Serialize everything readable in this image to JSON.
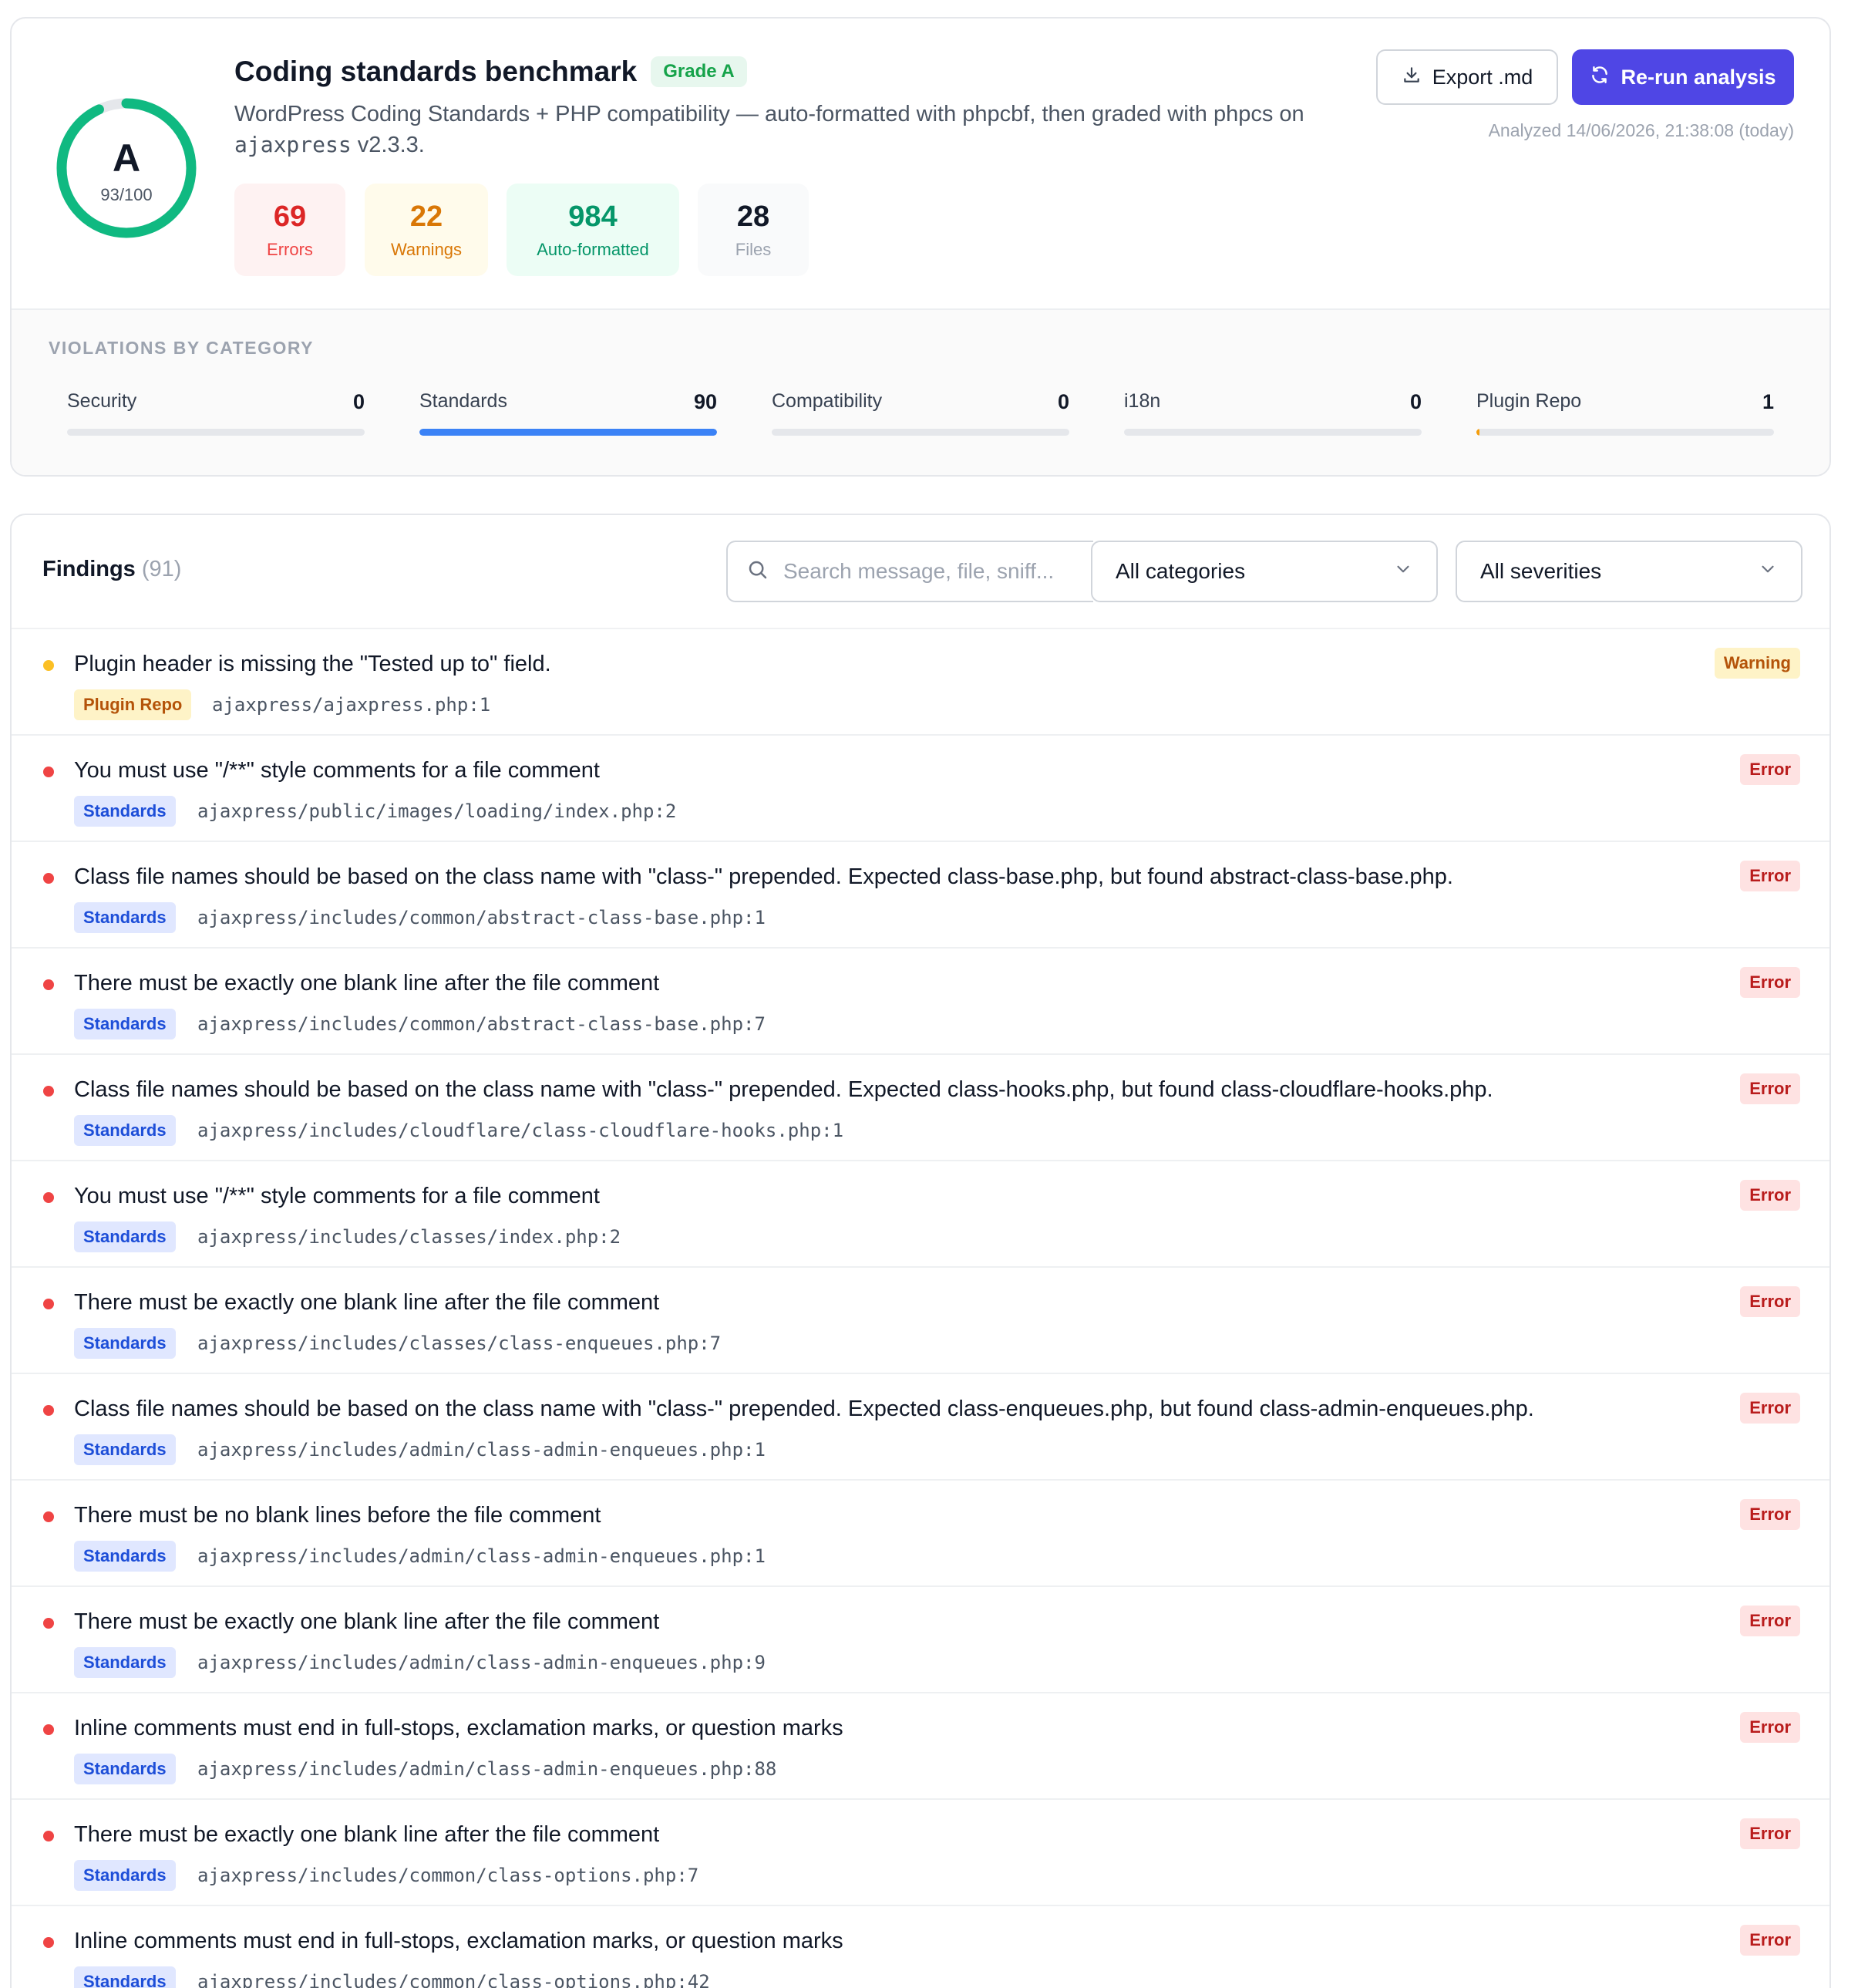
{
  "summary": {
    "grade_letter": "A",
    "score_text": "93/100",
    "score_value": 93,
    "score_max": 100,
    "title": "Coding standards benchmark",
    "grade_badge": "Grade A",
    "subtitle_text": "WordPress Coding Standards + PHP compatibility — auto-formatted with phpcbf, then graded with phpcs on",
    "subtitle_code": "ajaxpress",
    "subtitle_version": "v2.3.3.",
    "export_label": "Export .md",
    "rerun_label": "Re-run analysis",
    "analyzed_text": "Analyzed 14/06/2026, 21:38:08 (today)",
    "stats": {
      "errors": {
        "value": "69",
        "label": "Errors"
      },
      "warnings": {
        "value": "22",
        "label": "Warnings"
      },
      "auto": {
        "value": "984",
        "label": "Auto-formatted"
      },
      "files": {
        "value": "28",
        "label": "Files"
      }
    }
  },
  "violations": {
    "title": "VIOLATIONS BY CATEGORY",
    "max": 90,
    "categories": [
      {
        "label": "Security",
        "count": "0",
        "value": 0,
        "color": "#e5e7eb"
      },
      {
        "label": "Standards",
        "count": "90",
        "value": 90,
        "color": "#3b82f6"
      },
      {
        "label": "Compatibility",
        "count": "0",
        "value": 0,
        "color": "#e5e7eb"
      },
      {
        "label": "i18n",
        "count": "0",
        "value": 0,
        "color": "#e5e7eb"
      },
      {
        "label": "Plugin Repo",
        "count": "1",
        "value": 1,
        "color": "#f59e0b"
      }
    ]
  },
  "findings": {
    "title": "Findings",
    "count": "(91)",
    "search_placeholder": "Search message, file, sniff...",
    "category_select": "All categories",
    "severity_select": "All severities",
    "rows": [
      {
        "message": "Plugin header is missing the \"Tested up to\" field.",
        "category": "Plugin Repo",
        "file": "ajaxpress/ajaxpress.php:1",
        "severity": "Warning"
      },
      {
        "message": "You must use \"/**\" style comments for a file comment",
        "category": "Standards",
        "file": "ajaxpress/public/images/loading/index.php:2",
        "severity": "Error"
      },
      {
        "message": "Class file names should be based on the class name with \"class-\" prepended. Expected class-base.php, but found abstract-class-base.php.",
        "category": "Standards",
        "file": "ajaxpress/includes/common/abstract-class-base.php:1",
        "severity": "Error"
      },
      {
        "message": "There must be exactly one blank line after the file comment",
        "category": "Standards",
        "file": "ajaxpress/includes/common/abstract-class-base.php:7",
        "severity": "Error"
      },
      {
        "message": "Class file names should be based on the class name with \"class-\" prepended. Expected class-hooks.php, but found class-cloudflare-hooks.php.",
        "category": "Standards",
        "file": "ajaxpress/includes/cloudflare/class-cloudflare-hooks.php:1",
        "severity": "Error"
      },
      {
        "message": "You must use \"/**\" style comments for a file comment",
        "category": "Standards",
        "file": "ajaxpress/includes/classes/index.php:2",
        "severity": "Error"
      },
      {
        "message": "There must be exactly one blank line after the file comment",
        "category": "Standards",
        "file": "ajaxpress/includes/classes/class-enqueues.php:7",
        "severity": "Error"
      },
      {
        "message": "Class file names should be based on the class name with \"class-\" prepended. Expected class-enqueues.php, but found class-admin-enqueues.php.",
        "category": "Standards",
        "file": "ajaxpress/includes/admin/class-admin-enqueues.php:1",
        "severity": "Error"
      },
      {
        "message": "There must be no blank lines before the file comment",
        "category": "Standards",
        "file": "ajaxpress/includes/admin/class-admin-enqueues.php:1",
        "severity": "Error"
      },
      {
        "message": "There must be exactly one blank line after the file comment",
        "category": "Standards",
        "file": "ajaxpress/includes/admin/class-admin-enqueues.php:9",
        "severity": "Error"
      },
      {
        "message": "Inline comments must end in full-stops, exclamation marks, or question marks",
        "category": "Standards",
        "file": "ajaxpress/includes/admin/class-admin-enqueues.php:88",
        "severity": "Error"
      },
      {
        "message": "There must be exactly one blank line after the file comment",
        "category": "Standards",
        "file": "ajaxpress/includes/common/class-options.php:7",
        "severity": "Error"
      },
      {
        "message": "Inline comments must end in full-stops, exclamation marks, or question marks",
        "category": "Standards",
        "file": "ajaxpress/includes/common/class-options.php:42",
        "severity": "Error"
      }
    ]
  }
}
